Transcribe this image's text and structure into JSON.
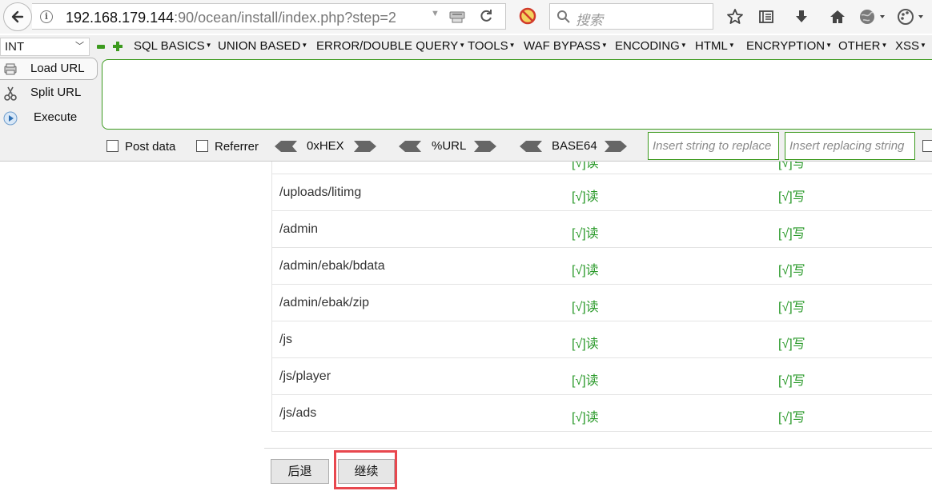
{
  "browser": {
    "url_host": "192.168.179.144",
    "url_rest": ":90/ocean/install/index.php?step=2",
    "search_placeholder": "搜索"
  },
  "hackbar": {
    "select_value": "INT",
    "menus": [
      "SQL BASICS",
      "UNION BASED",
      "ERROR/DOUBLE QUERY",
      "TOOLS",
      "WAF BYPASS",
      "ENCODING",
      "HTML",
      "ENCRYPTION",
      "OTHER",
      "XSS"
    ],
    "load_url": "Load URL",
    "split_url": "Split URL",
    "execute": "Execute",
    "url_value": "",
    "post_data": "Post data",
    "referrer": "Referrer",
    "hex": "0xHEX",
    "url_enc": "%URL",
    "base64": "BASE64",
    "insert_placeholder": "Insert string to replace",
    "replacing_placeholder": "Insert replacing string"
  },
  "table": {
    "partial_row": {
      "read": "[√]读",
      "write": "[√]写"
    },
    "rows": [
      {
        "path": "/uploads/litimg",
        "read": "[√]读",
        "write": "[√]写"
      },
      {
        "path": "/admin",
        "read": "[√]读",
        "write": "[√]写"
      },
      {
        "path": "/admin/ebak/bdata",
        "read": "[√]读",
        "write": "[√]写"
      },
      {
        "path": "/admin/ebak/zip",
        "read": "[√]读",
        "write": "[√]写"
      },
      {
        "path": "/js",
        "read": "[√]读",
        "write": "[√]写"
      },
      {
        "path": "/js/player",
        "read": "[√]读",
        "write": "[√]写"
      },
      {
        "path": "/js/ads",
        "read": "[√]读",
        "write": "[√]写"
      }
    ]
  },
  "buttons": {
    "back": "后退",
    "continue": "继续"
  },
  "colors": {
    "ok_green": "#2a9a2a",
    "highlight_red": "#e8474e",
    "hackbar_green": "#3c9a1e"
  }
}
